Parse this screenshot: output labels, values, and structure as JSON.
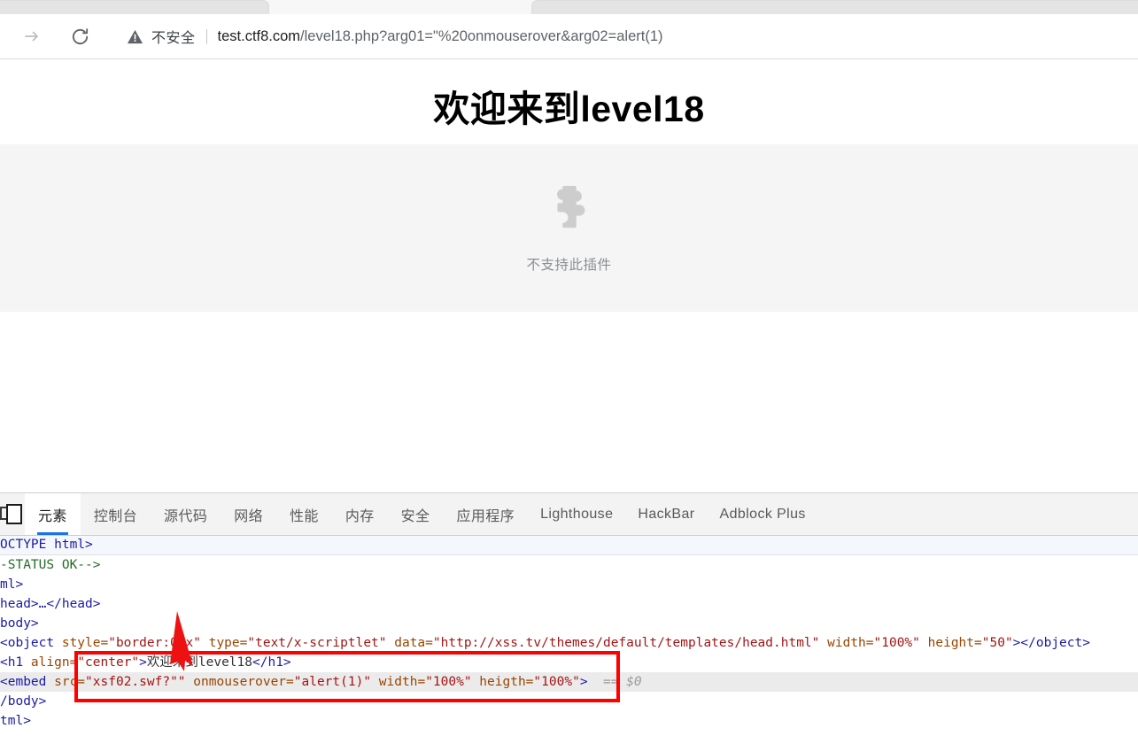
{
  "browser": {
    "tabstrip": {
      "tab_left": "",
      "tab_right": ""
    },
    "nav": {
      "forward_label": "forward-arrow",
      "reload_label": "reload"
    },
    "omnibox": {
      "security_icon": "warning-triangle-icon",
      "security_text": "不安全",
      "url_host": "test.ctf8.com",
      "url_path": "/level18.php?arg01=\"%20onmouserover&arg02=alert(1)",
      "url_full": "test.ctf8.com/level18.php?arg01=\"%20onmouserover&arg02=alert(1)"
    }
  },
  "page": {
    "heading": "欢迎来到level18",
    "plugin": {
      "icon": "puzzle-piece-icon",
      "label": "不支持此插件"
    }
  },
  "devtools": {
    "inspect_icon": "device-toolbar-icon",
    "tabs": [
      {
        "label": "元素",
        "active": true
      },
      {
        "label": "控制台",
        "active": false
      },
      {
        "label": "源代码",
        "active": false
      },
      {
        "label": "网络",
        "active": false
      },
      {
        "label": "性能",
        "active": false
      },
      {
        "label": "内存",
        "active": false
      },
      {
        "label": "安全",
        "active": false
      },
      {
        "label": "应用程序",
        "active": false
      },
      {
        "label": "Lighthouse",
        "active": false
      },
      {
        "label": "HackBar",
        "active": false
      },
      {
        "label": "Adblock Plus",
        "active": false
      }
    ],
    "dom": {
      "line_doctype": "OCTYPE html>",
      "line_comment": "-STATUS OK-->",
      "line_html": "ml>",
      "line_head": "head>…</head>",
      "line_body": "body>",
      "object": {
        "open": "<object",
        "attr_style": " style=",
        "val_style": "\"border:0px\"",
        "attr_type": " type=",
        "val_type": "\"text/x-scriptlet\"",
        "attr_data": " data=",
        "val_data": "\"http://xss.tv/themes/default/templates/head.html\"",
        "attr_width": " width=",
        "val_width": "\"100%\"",
        "attr_height": " height=",
        "val_height": "\"50\"",
        "close": "></object>"
      },
      "h1": {
        "open": "<h1",
        "attr_align": " align=",
        "val_align": "\"center\"",
        "gt": ">",
        "text": "欢迎来到level18",
        "close": "</h1>"
      },
      "embed": {
        "open": "<embed",
        "attr_src": " src=",
        "val_src": "\"xsf02.swf?\"\"",
        "attr_onmouserover": " onmouserover=",
        "val_onmouserover": "\"alert(1)\"",
        "attr_width": " width=",
        "val_width": "\"100%\"",
        "attr_heigth": " heigth=",
        "val_heigth": "\"100%\"",
        "close": ">",
        "selected_marker": "== $0"
      },
      "line_body_close": "/body>",
      "line_html_close": "tml>"
    }
  },
  "annotation": {
    "box_color": "#ff0000",
    "arrow_color": "#ee1111",
    "box_name": "embed-highlight-box",
    "arrow_name": "pointer-arrow"
  }
}
